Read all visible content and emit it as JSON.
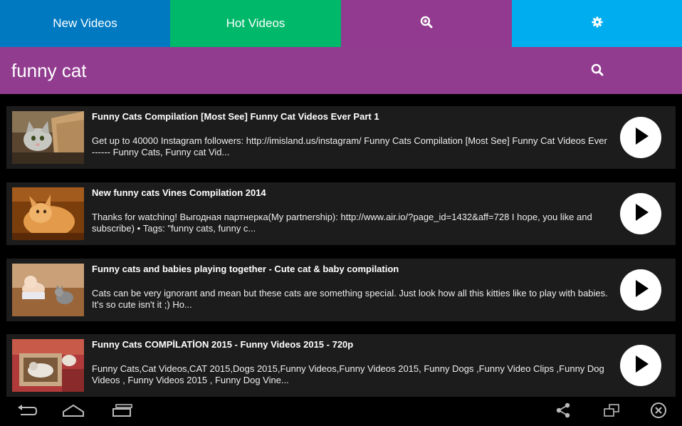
{
  "colors": {
    "tab_new": "#0079c1",
    "tab_hot": "#00b86a",
    "tab_search": "#913a8f",
    "tab_settings": "#00adef",
    "searchbar": "#923c90",
    "item_bg": "#1c1c1c"
  },
  "tabs": [
    {
      "label": "New Videos",
      "icon": "text"
    },
    {
      "label": "Hot Videos",
      "icon": "text"
    },
    {
      "label": "",
      "icon": "zoom-in-icon"
    },
    {
      "label": "",
      "icon": "gear-icon"
    }
  ],
  "search": {
    "query": "funny cat",
    "icon": "search-icon"
  },
  "videos": [
    {
      "title": "Funny Cats Compilation [Most See] Funny Cat Videos Ever Part 1",
      "description": "Get up to 40000 Instagram followers: http://imisland.us/instagram/ Funny Cats Compilation [Most See] Funny Cat Videos Ever ------ Funny Cats, Funny cat Vid..."
    },
    {
      "title": "New funny cats Vines Compilation 2014",
      "description": "Thanks for watching! Выгодная партнерка(My partnership): http://www.air.io/?page_id=1432&aff=728 I hope, you like and subscribe) • Tags: \"funny cats, funny c..."
    },
    {
      "title": "Funny cats and babies playing together - Cute cat & baby compilation",
      "description": "Cats can be very ignorant and mean but these cats are something special. Just look how all this kitties like to play with babies. It's so cute isn't it ;) Ho..."
    },
    {
      "title": "Funny Cats COMPİLATİON 2015 - Funny Videos 2015 - 720p",
      "description": "Funny Cats,Cat Videos,CAT 2015,Dogs 2015,Funny Videos,Funny Videos 2015, Funny Dogs ,Funny Video Clips ,Funny Dog Videos , Funny Videos 2015 , Funny Dog Vine..."
    }
  ],
  "navbar": {
    "left": [
      "back-icon",
      "home-icon",
      "recent-apps-icon"
    ],
    "right": [
      "share-icon",
      "window-icon",
      "close-icon"
    ]
  }
}
